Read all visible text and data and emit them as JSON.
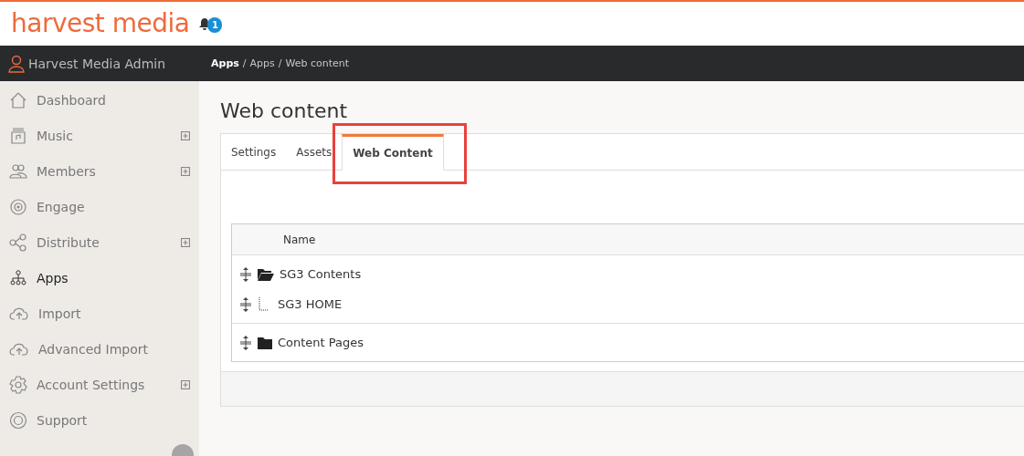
{
  "brand": {
    "logo": "harvest media",
    "notifications": "1"
  },
  "user": {
    "name": "Harvest Media Admin"
  },
  "breadcrumbs": [
    {
      "label": "Apps",
      "bold": true
    },
    {
      "separator": "/",
      "label": "Apps",
      "bold": false
    },
    {
      "separator": "/",
      "label": "Web content",
      "bold": false
    }
  ],
  "sidebar": {
    "items": [
      {
        "label": "Dashboard",
        "expandable": false,
        "selected": false
      },
      {
        "label": "Music",
        "expandable": true,
        "selected": false
      },
      {
        "label": "Members",
        "expandable": true,
        "selected": false
      },
      {
        "label": "Engage",
        "expandable": false,
        "selected": false
      },
      {
        "label": "Distribute",
        "expandable": true,
        "selected": false
      },
      {
        "label": "Apps",
        "expandable": false,
        "selected": true
      },
      {
        "label": "Import",
        "expandable": false,
        "selected": false
      },
      {
        "label": "Advanced Import",
        "expandable": false,
        "selected": false
      },
      {
        "label": "Account Settings",
        "expandable": true,
        "selected": false
      },
      {
        "label": "Support",
        "expandable": false,
        "selected": false
      }
    ]
  },
  "page": {
    "title": "Web content"
  },
  "tabs": [
    {
      "label": "Settings",
      "selected": false,
      "highlighted": false
    },
    {
      "label": "Assets",
      "selected": false,
      "highlighted": false
    },
    {
      "label": "Web Content",
      "selected": true,
      "highlighted": true
    }
  ],
  "table": {
    "columns": [
      "Name"
    ],
    "rows": [
      {
        "name": "SG3 Contents",
        "expanded": true,
        "children": [
          {
            "name": "SG3 HOME"
          }
        ]
      },
      {
        "name": "Content Pages",
        "expanded": false
      }
    ]
  }
}
